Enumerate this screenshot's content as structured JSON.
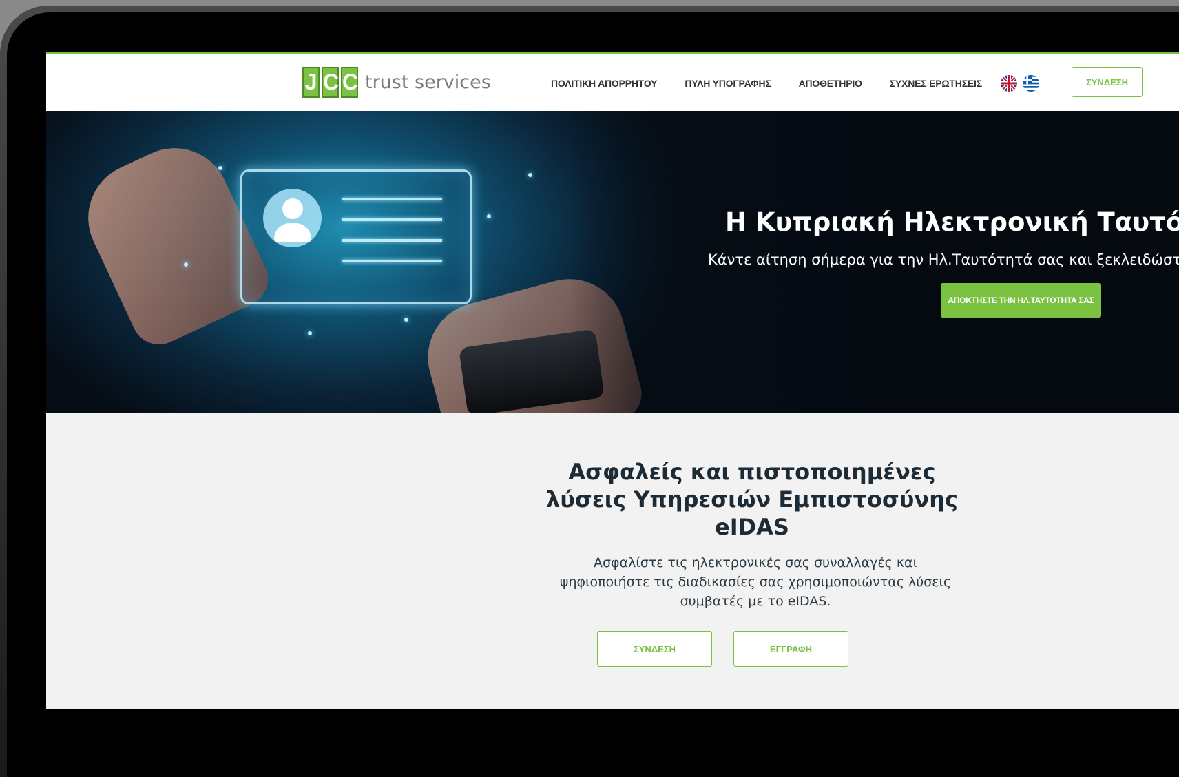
{
  "nav": {
    "logo_letters": [
      "J",
      "C",
      "C"
    ],
    "logo_text": "trust services",
    "menu": [
      {
        "label": "ΠΟΛΙΤΙΚΗ ΑΠΟΡΡΗΤΟΥ"
      },
      {
        "label": "ΠΥΛΗ ΥΠΟΓΡΑΦΗΣ"
      },
      {
        "label": "ΑΠΟΘΕΤΗΡΙΟ"
      },
      {
        "label": "ΣΥΧΝΕΣ ΕΡΩΤΗΣΕΙΣ"
      }
    ],
    "flags": [
      "uk-flag-icon",
      "greece-flag-icon"
    ],
    "login_label": "ΣΥΝΔΕΣΗ"
  },
  "hero": {
    "title": "Η Κυπριακή Ηλεκτρονική Ταυτότητα",
    "subtitle": "Κάντε αίτηση σήμερα για την Ηλ.Ταυτότητά σας και ξεκλειδώστε",
    "button_label": "ΑΠΟΚΤΗΣΤΕ ΤΗΝ ΗΛ.ΤΑΥΤΟΤΗΤΑ ΣΑΣ"
  },
  "section": {
    "heading": "Ασφαλείς και πιστοποιημένες λύσεις Υπηρεσιών Εμπιστοσύνης eIDAS",
    "description": "Ασφαλίστε τις ηλεκτρονικές σας συναλλαγές και ψηφιοποιήστε τις διαδικασίες σας χρησιμοποιώντας λύσεις συμβατές με το eIDAS.",
    "login_label": "ΣΥΝΔΕΣΗ",
    "register_label": "ΕΓΓΡΑΦΗ"
  },
  "colors": {
    "brand_green": "#7cc242",
    "heading_dark": "#1d2b36"
  }
}
